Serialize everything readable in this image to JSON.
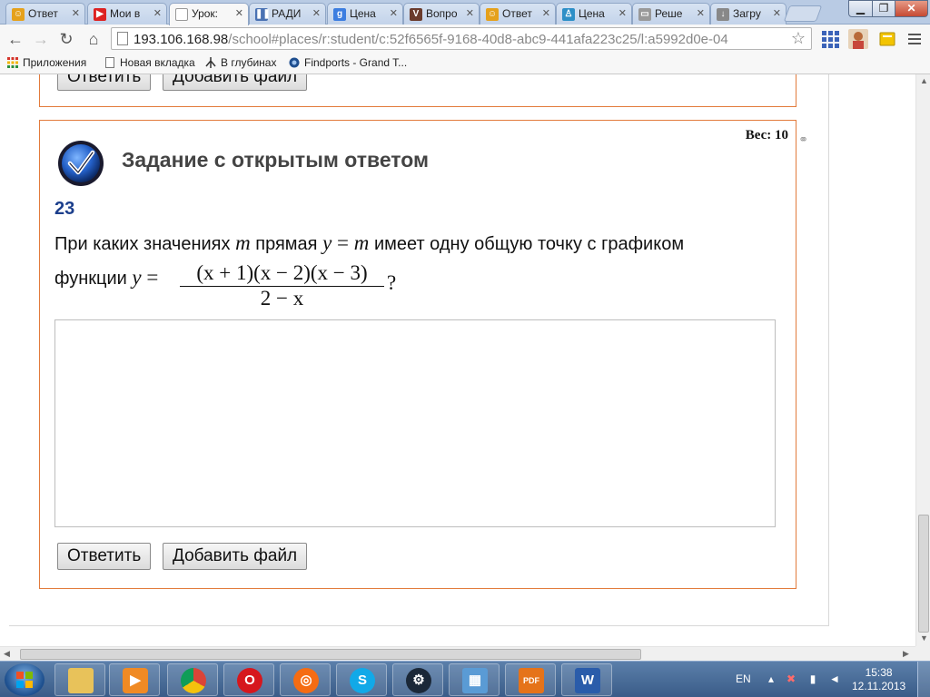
{
  "tabs": [
    {
      "label": "Ответ",
      "favicon": "smiley-icon",
      "color": "#e5a11c",
      "active": false
    },
    {
      "label": "Мои в",
      "favicon": "youtube-icon",
      "color": "#d22",
      "active": false
    },
    {
      "label": "Урок:",
      "favicon": "page-icon",
      "color": "#fff",
      "active": true
    },
    {
      "label": "РАДИ",
      "favicon": "pause-icon",
      "color": "#4a72b3",
      "active": false
    },
    {
      "label": "Цена",
      "favicon": "google-icon",
      "color": "#3d7ee0",
      "active": false
    },
    {
      "label": "Вопро",
      "favicon": "v-icon",
      "color": "#6a3b2c",
      "active": false
    },
    {
      "label": "Ответ",
      "favicon": "smiley-icon",
      "color": "#e5a11c",
      "active": false
    },
    {
      "label": "Цена",
      "favicon": "figure-icon",
      "color": "#2d8fc7",
      "active": false
    },
    {
      "label": "Реше",
      "favicon": "monitor-icon",
      "color": "#777",
      "active": false
    },
    {
      "label": "Загру",
      "favicon": "download-icon",
      "color": "#777",
      "active": false
    }
  ],
  "omnibox": {
    "host": "193.106.168.98",
    "path": "/school#places/r:student/c:52f6565f-9168-40d8-abc9-441afa223c25/l:a5992d0e-04"
  },
  "bookmarks": [
    {
      "label": "Приложения",
      "icon": "apps-icon"
    },
    {
      "label": "Новая вкладка",
      "icon": "page-icon"
    },
    {
      "label": "В глубинах",
      "icon": "anchor-icon"
    },
    {
      "label": "Findports - Grand T...",
      "icon": "globe-icon"
    }
  ],
  "previous_card": {
    "answer_button": "Ответить",
    "attach_button": "Добавить файл"
  },
  "card": {
    "weight": "Вес: 10",
    "title": "Задание с открытым ответом",
    "number": "23",
    "question": {
      "line1_a": "При каких значениях ",
      "var_m": "m",
      "line1_b": " прямая ",
      "eq_y": "y",
      "eq_sign": " = ",
      "eq_m": "m",
      "line1_c": " имеет одну общую точку с графиком",
      "line2_a": "функции ",
      "line2_y": "y",
      "line2_eq": " =",
      "numerator": "(x + 1)(x − 2)(x − 3)",
      "denominator": "2 − x",
      "end": "?"
    },
    "answer_value": "",
    "answer_button": "Ответить",
    "attach_button": "Добавить файл"
  },
  "taskbar": {
    "apps": [
      {
        "name": "explorer",
        "icon": "folder-icon",
        "color": "#e8c25a",
        "glyph": ""
      },
      {
        "name": "media-player",
        "icon": "media-player-icon",
        "color": "#f08a24",
        "glyph": "▶"
      },
      {
        "name": "chrome",
        "icon": "chrome-icon",
        "color": "#3ea84b",
        "glyph": "◉"
      },
      {
        "name": "opera",
        "icon": "opera-icon",
        "color": "#d6171d",
        "glyph": "O"
      },
      {
        "name": "origin",
        "icon": "origin-icon",
        "color": "#f56c13",
        "glyph": "◎"
      },
      {
        "name": "skype",
        "icon": "skype-icon",
        "color": "#11a9e8",
        "glyph": "S"
      },
      {
        "name": "steam",
        "icon": "steam-icon",
        "color": "#1b2838",
        "glyph": "⚙"
      },
      {
        "name": "photo-viewer",
        "icon": "photo-icon",
        "color": "#5a9bd5",
        "glyph": "▦"
      },
      {
        "name": "pdf",
        "icon": "pdf-icon",
        "color": "#e5731a",
        "glyph": "PDF"
      },
      {
        "name": "word",
        "icon": "word-icon",
        "color": "#2a5caa",
        "glyph": "W"
      }
    ],
    "language": "EN",
    "time": "15:38",
    "date": "12.11.2013"
  }
}
